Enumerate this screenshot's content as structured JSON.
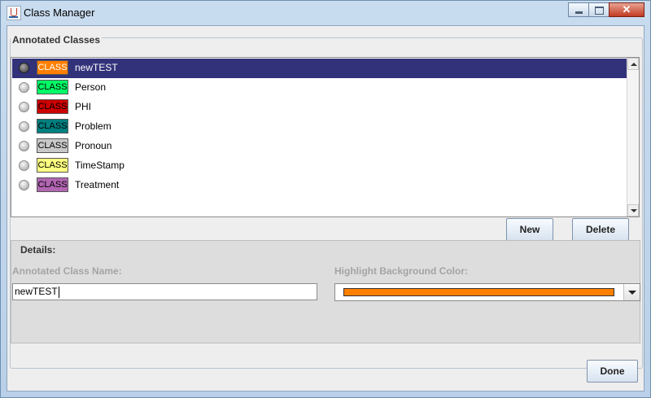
{
  "window": {
    "title": "Class Manager",
    "close_label": "✕"
  },
  "group": {
    "title": "Annotated Classes"
  },
  "badge_text": "CLASS",
  "classes": [
    {
      "name": "newTEST",
      "color": "#ff7f00",
      "selected": true
    },
    {
      "name": "Person",
      "color": "#00ff66"
    },
    {
      "name": "PHI",
      "color": "#cc0000"
    },
    {
      "name": "Problem",
      "color": "#007f7f"
    },
    {
      "name": "Pronoun",
      "color": "#c8c8c8"
    },
    {
      "name": "TimeStamp",
      "color": "#ffff80"
    },
    {
      "name": "Treatment",
      "color": "#b266b2"
    }
  ],
  "buttons": {
    "new": "New",
    "delete": "Delete",
    "done": "Done"
  },
  "details": {
    "title": "Details:",
    "name_label": "Annotated Class Name:",
    "name_value": "newTEST",
    "color_label": "Highlight Background Color:",
    "color_value": "#ff7f00"
  }
}
